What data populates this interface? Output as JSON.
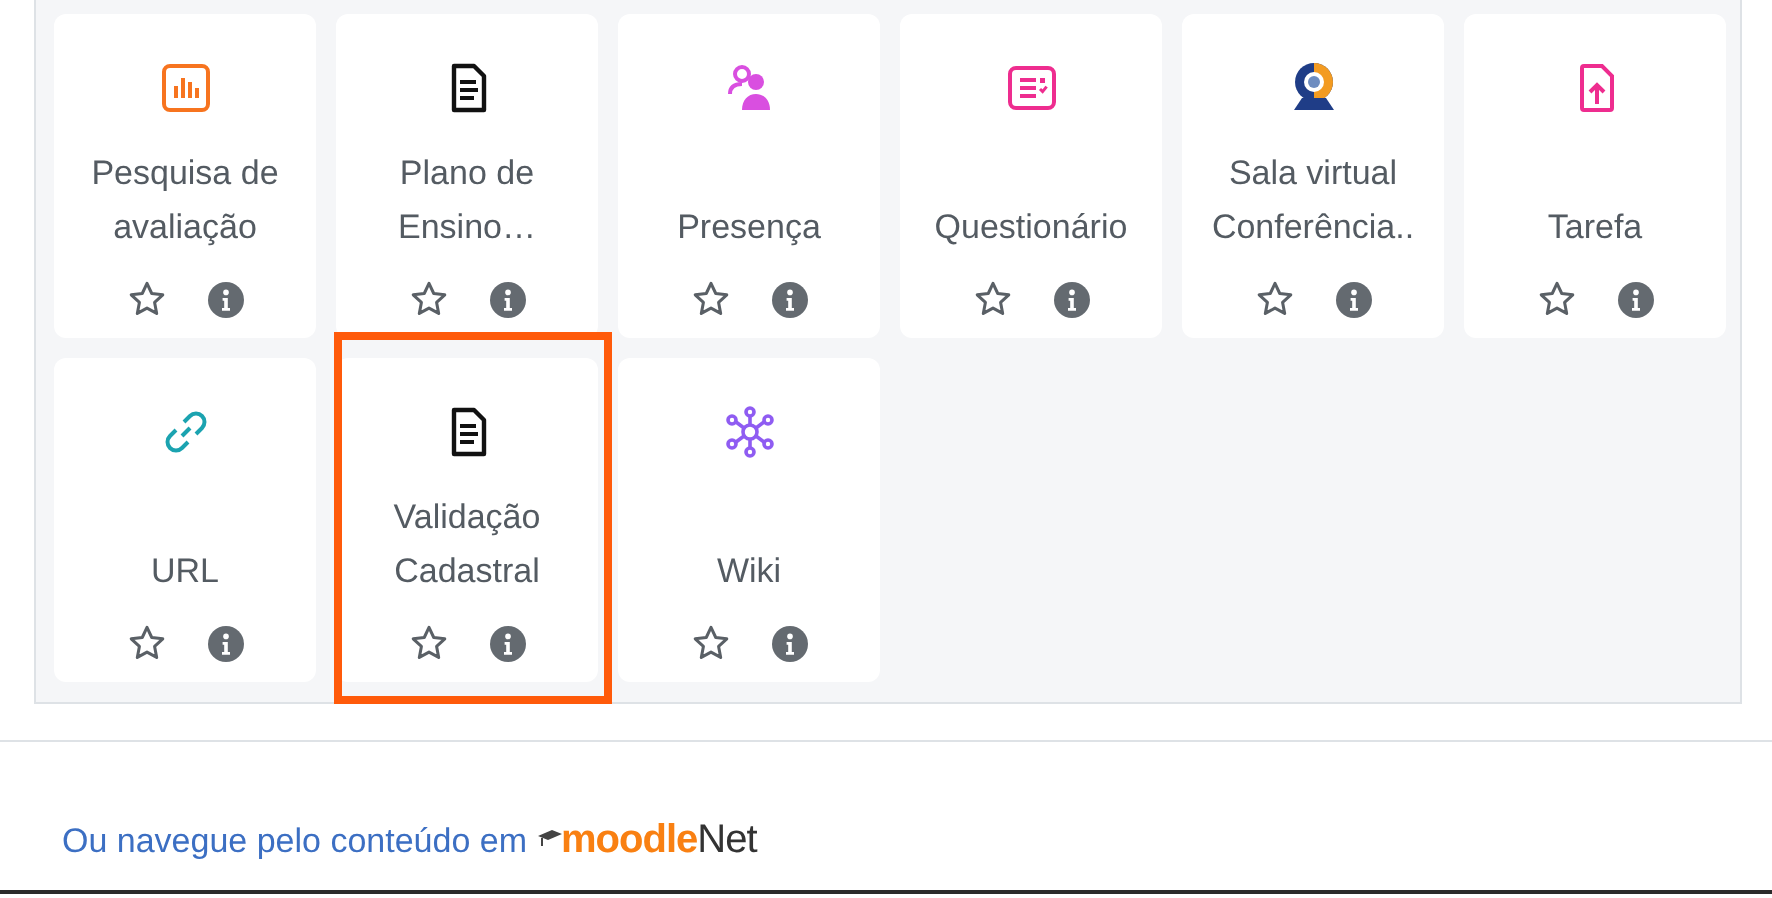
{
  "activities": [
    {
      "label": [
        "Pesquisa de",
        "avaliação"
      ],
      "kind": "chart",
      "starred": false,
      "highlighted": false
    },
    {
      "label": [
        "Plano de",
        "Ensino…"
      ],
      "kind": "document",
      "starred": false,
      "highlighted": false
    },
    {
      "label": [
        "Presença"
      ],
      "kind": "people",
      "starred": false,
      "highlighted": false
    },
    {
      "label": [
        "Questionário"
      ],
      "kind": "quiz",
      "starred": false,
      "highlighted": false
    },
    {
      "label": [
        "Sala virtual",
        "Conferência.."
      ],
      "kind": "webcam",
      "starred": false,
      "highlighted": false
    },
    {
      "label": [
        "Tarefa"
      ],
      "kind": "upload",
      "starred": false,
      "highlighted": false
    },
    {
      "label": [
        "URL"
      ],
      "kind": "link",
      "starred": false,
      "highlighted": false
    },
    {
      "label": [
        "Validação",
        "Cadastral"
      ],
      "kind": "document",
      "starred": false,
      "highlighted": true
    },
    {
      "label": [
        "Wiki"
      ],
      "kind": "network",
      "starred": false,
      "highlighted": false
    }
  ],
  "footer": {
    "text": "Ou navegue pelo conteúdo em",
    "logo_main": "moodle",
    "logo_suffix": "Net"
  }
}
